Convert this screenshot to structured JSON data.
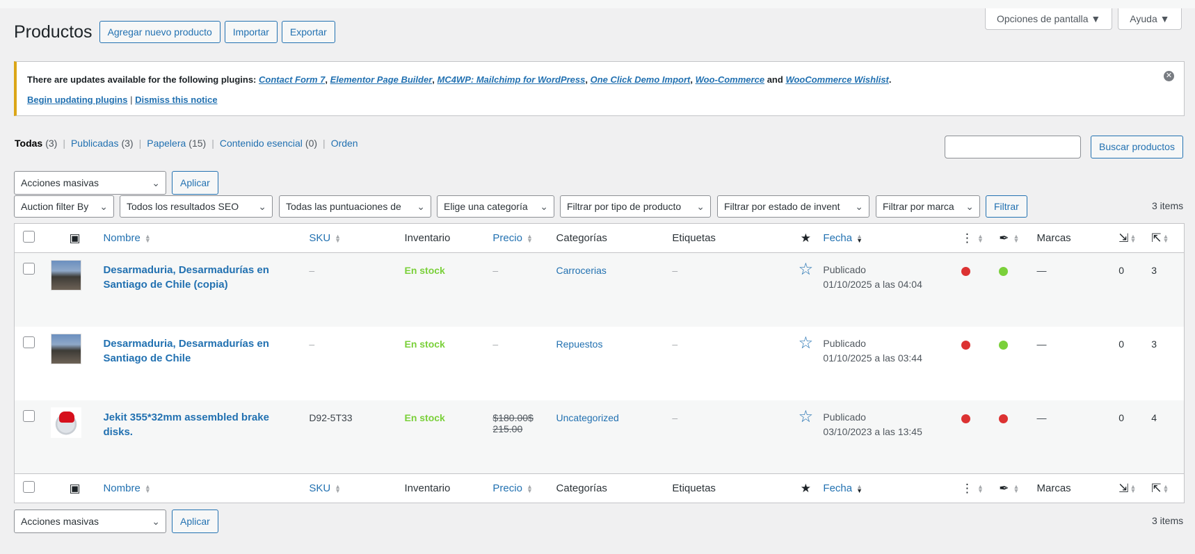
{
  "page": {
    "title": "Productos"
  },
  "header_buttons": {
    "add": "Agregar nuevo producto",
    "import": "Importar",
    "export": "Exportar"
  },
  "screen_meta": {
    "options": "Opciones de pantalla ▼",
    "help": "Ayuda ▼"
  },
  "notice": {
    "intro": "There are updates available for the following plugins:",
    "plugins": [
      "Contact Form 7",
      "Elementor Page Builder",
      "MC4WP: Mailchimp for WordPress",
      "One Click Demo Import",
      "Woo-Commerce",
      "WooCommerce Wishlist"
    ],
    "and": "and",
    "begin": "Begin updating plugins",
    "dismiss": "Dismiss this notice"
  },
  "views": [
    {
      "label": "Todas",
      "count": "(3)"
    },
    {
      "label": "Publicadas",
      "count": "(3)"
    },
    {
      "label": "Papelera",
      "count": "(15)"
    },
    {
      "label": "Contenido esencial",
      "count": "(0)"
    },
    {
      "label": "Orden",
      "count": ""
    }
  ],
  "search": {
    "button": "Buscar productos"
  },
  "bulk": {
    "select": "Acciones masivas",
    "apply": "Aplicar"
  },
  "filters": {
    "auction": "Auction filter By",
    "seo": "Todos los resultados SEO",
    "scores": "Todas las puntuaciones de",
    "category": "Elige una categoría",
    "type": "Filtrar por tipo de producto",
    "stock": "Filtrar por estado de invent",
    "brand": "Filtrar por marca",
    "filter_button": "Filtrar"
  },
  "items_count": "3 items",
  "columns": {
    "name": "Nombre",
    "sku": "SKU",
    "inventory": "Inventario",
    "price": "Precio",
    "categories": "Categorías",
    "tags": "Etiquetas",
    "date": "Fecha",
    "brands": "Marcas"
  },
  "products": [
    {
      "name": "Desarmaduria, Desarmadurías en Santiago de Chile (copia)",
      "sku": "–",
      "stock": "En stock",
      "price": "–",
      "price_old": "",
      "category": "Carrocerias",
      "tags": "–",
      "status": "Publicado",
      "date": "01/10/2025 a las 04:04",
      "seo": "red",
      "readability": "green",
      "brand": "—",
      "links_in": "0",
      "links_out": "3"
    },
    {
      "name": "Desarmaduria, Desarmadurías en Santiago de Chile",
      "sku": "–",
      "stock": "En stock",
      "price": "–",
      "price_old": "",
      "category": "Repuestos",
      "tags": "–",
      "status": "Publicado",
      "date": "01/10/2025 a las 03:44",
      "seo": "red",
      "readability": "green",
      "brand": "—",
      "links_in": "0",
      "links_out": "3"
    },
    {
      "name": "Jekit 355*32mm assembled brake disks.",
      "sku": "D92-5T33",
      "stock": "En stock",
      "price": "$180.00$",
      "price_old": "215.00",
      "category": "Uncategorized",
      "tags": "–",
      "status": "Publicado",
      "date": "03/10/2023 a las 13:45",
      "seo": "red",
      "readability": "red",
      "brand": "—",
      "links_in": "0",
      "links_out": "4"
    }
  ],
  "colors": {
    "accent": "#2271b1",
    "in_stock": "#7ad03a",
    "seo_red": "#dc3232",
    "notice_border": "#dba617"
  }
}
